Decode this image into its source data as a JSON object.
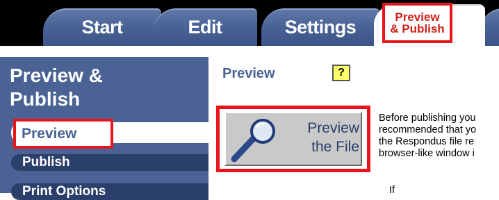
{
  "tabs": [
    {
      "label": "Start"
    },
    {
      "label": "Edit"
    },
    {
      "label": "Settings"
    },
    {
      "label_line1": "Preview",
      "label_line2": "& Publish"
    }
  ],
  "sidebar": {
    "title_line1": "Preview &",
    "title_line2": "Publish",
    "items": [
      {
        "label": "Preview"
      },
      {
        "label": "Publish"
      },
      {
        "label": "Print Options"
      }
    ]
  },
  "main": {
    "heading": "Preview",
    "help_label": "?",
    "preview_button_line1": "Preview",
    "preview_button_line2": "the File",
    "description_lines": [
      "Before publishing you",
      "recommended that yo",
      "the Respondus file re",
      "browser-like window i"
    ],
    "description_bottom": "If"
  },
  "colors": {
    "sidebar_bg": "#4a6394",
    "nav_item_bg": "#2b3f6b",
    "highlight_red": "#e8141c",
    "active_tab_text": "#cc1f18",
    "help_bg": "#ffff66"
  },
  "icons": {
    "preview_button_icon": "magnifier-icon"
  }
}
